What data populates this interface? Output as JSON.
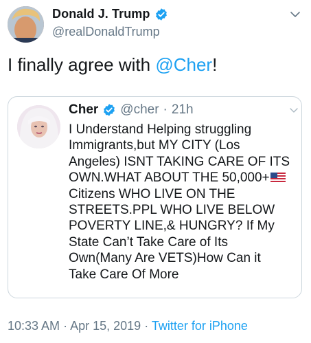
{
  "tweet": {
    "author_name": "Donald J. Trump",
    "author_handle": "@realDonaldTrump",
    "verified": true,
    "text_prefix": "I finally agree with ",
    "text_mention": "@Cher",
    "text_suffix": "!",
    "avatar_icon": "user-photo-avatar",
    "menu_icon": "chevron-down-icon"
  },
  "quoted_tweet": {
    "author_name": "Cher",
    "author_handle": "@cher",
    "separator": "·",
    "time_ago": "21h",
    "verified": true,
    "avatar_icon": "user-photo-avatar",
    "menu_icon": "chevron-down-icon",
    "lines": [
      "I Understand Helping struggling",
      "Immigrants,but MY CITY (Los",
      "Angeles) ISNT TAKING CARE OF ITS",
      "OWN.WHAT ABOUT THE 50,000+",
      "Citizens WHO LIVE ON THE",
      "STREETS.PPL WHO LIVE BELOW",
      "POVERTY LINE,& HUNGRY? If My",
      "State Can’t Take Care of Its",
      "Own(Many Are VETS)How Can it",
      "Take Care Of More"
    ],
    "flag_icon": "us-flag-icon"
  },
  "footer": {
    "time": "10:33 AM",
    "separator": "·",
    "date": "Apr 15, 2019",
    "source": "Twitter for iPhone"
  },
  "colors": {
    "accent": "#1da1f2",
    "secondary_text": "#657786",
    "border": "#ccd6dd"
  }
}
